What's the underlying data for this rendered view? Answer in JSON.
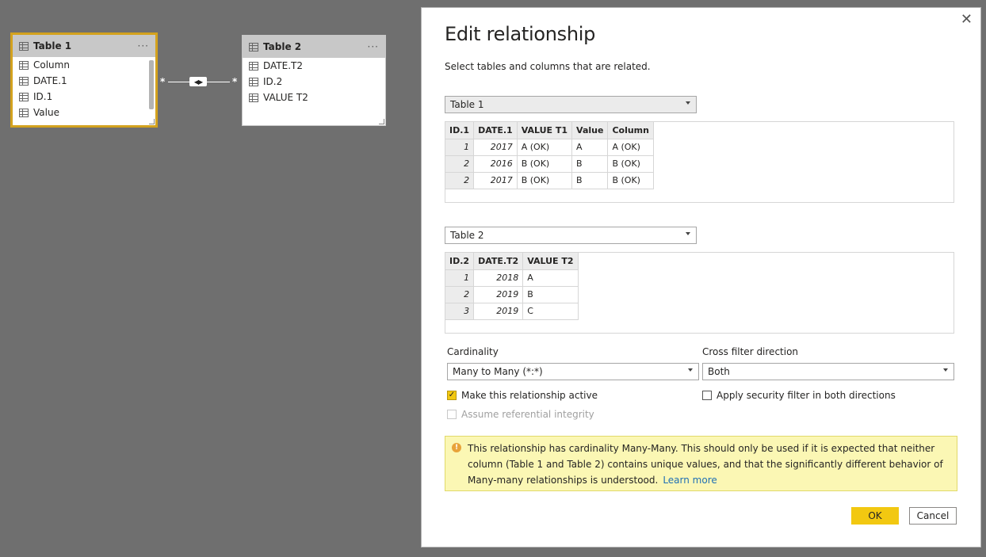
{
  "canvas": {
    "table1": {
      "title": "Table 1",
      "more": "···",
      "columns": [
        "Column",
        "DATE.1",
        "ID.1",
        "Value"
      ]
    },
    "table2": {
      "title": "Table 2",
      "more": "···",
      "columns": [
        "DATE.T2",
        "ID.2",
        "VALUE T2"
      ]
    },
    "relationship": {
      "left_card": "*",
      "right_card": "*",
      "cross_filter": "◀▶"
    }
  },
  "dialog": {
    "close": "✕",
    "title": "Edit relationship",
    "subtitle": "Select tables and columns that are related.",
    "table1_select": "Table 1",
    "table1_preview": {
      "headers": [
        "ID.1",
        "DATE.1",
        "VALUE T1",
        "Value",
        "Column"
      ],
      "rows": [
        [
          "1",
          "2017",
          "A (OK)",
          "A",
          "A (OK)"
        ],
        [
          "2",
          "2016",
          "B (OK)",
          "B",
          "B (OK)"
        ],
        [
          "2",
          "2017",
          "B (OK)",
          "B",
          "B (OK)"
        ]
      ]
    },
    "table2_select": "Table 2",
    "table2_preview": {
      "headers": [
        "ID.2",
        "DATE.T2",
        "VALUE T2"
      ],
      "rows": [
        [
          "1",
          "2018",
          "A"
        ],
        [
          "2",
          "2019",
          "B"
        ],
        [
          "3",
          "2019",
          "C"
        ]
      ]
    },
    "cardinality_label": "Cardinality",
    "cardinality_value": "Many to Many (*:*)",
    "cross_filter_label": "Cross filter direction",
    "cross_filter_value": "Both",
    "make_active_label": "Make this relationship active",
    "make_active_checked": true,
    "security_filter_label": "Apply security filter in both directions",
    "security_filter_checked": false,
    "referential_label": "Assume referential integrity",
    "warning_text": "This relationship has cardinality Many-Many. This should only be used if it is expected that neither column (Table 1 and Table 2) contains unique values, and that the significantly different behavior of Many-many relationships is understood.",
    "learn_more": "Learn more",
    "ok_label": "OK",
    "cancel_label": "Cancel"
  },
  "colors": {
    "accent": "#f2c811",
    "selection_border": "#d3a21e",
    "warning_bg": "#fbf7b4",
    "link": "#1f6fb4"
  }
}
